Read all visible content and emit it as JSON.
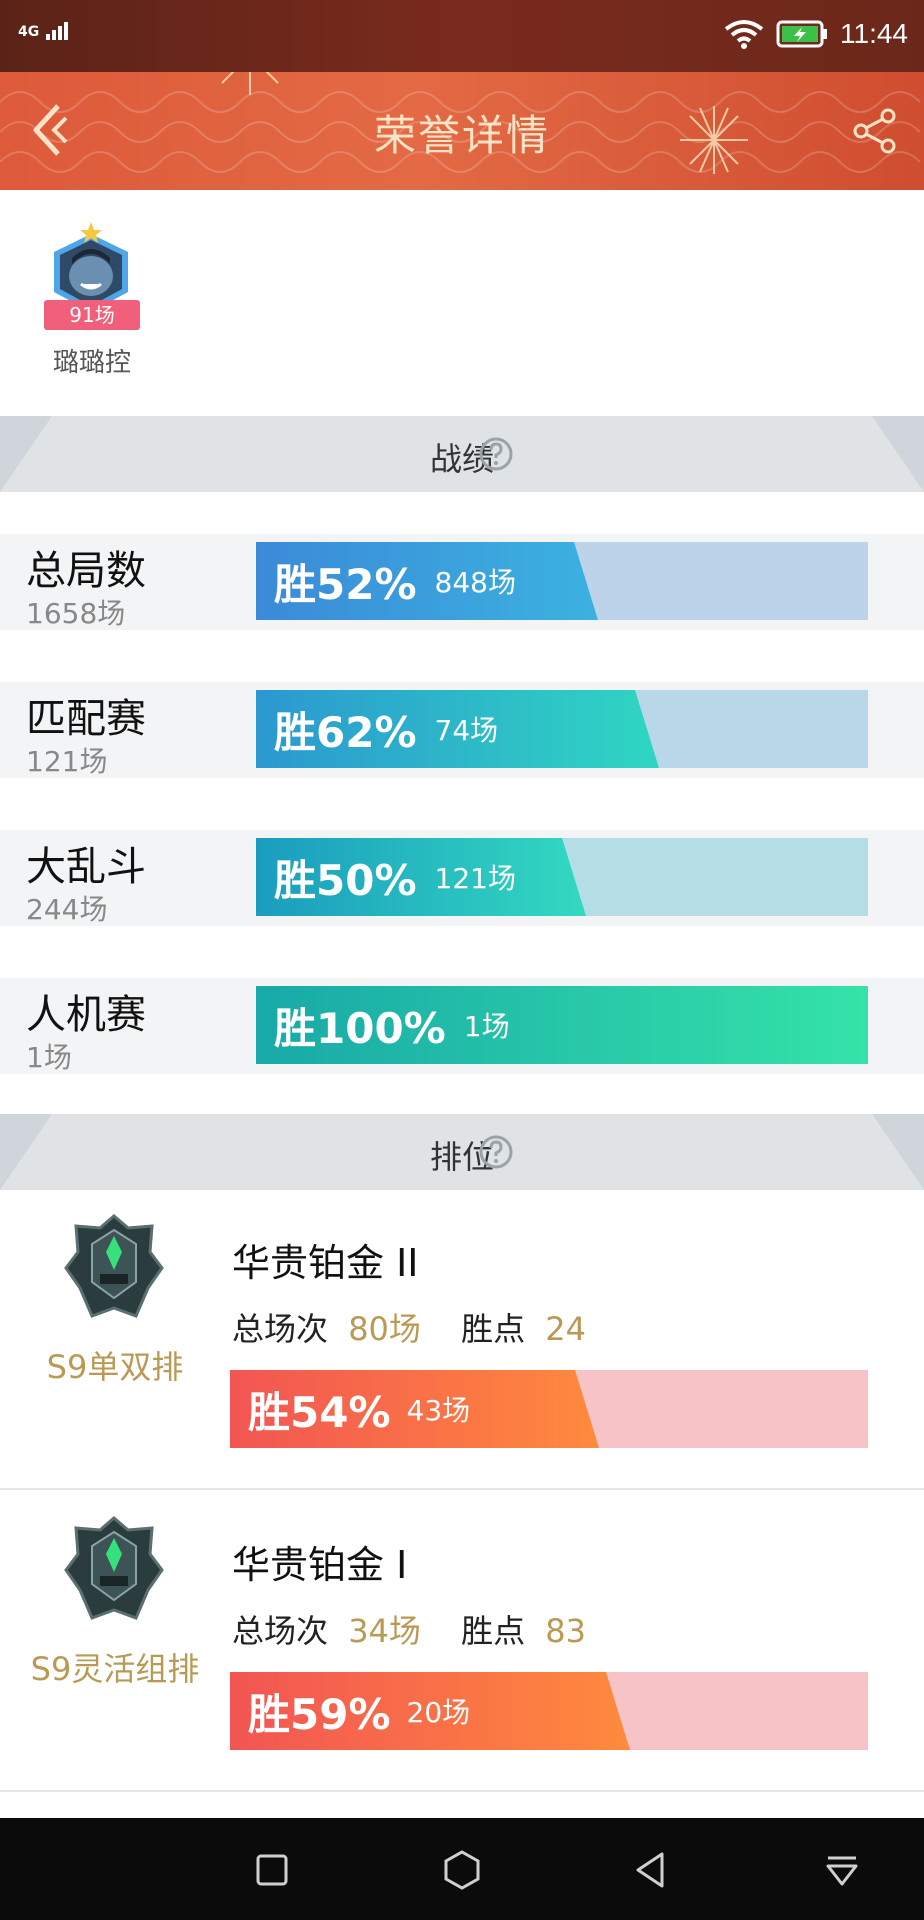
{
  "status_bar": {
    "network": "4G",
    "time": "11:44"
  },
  "header": {
    "title": "荣誉详情"
  },
  "hero": {
    "badge": "91场",
    "name": "璐璐控"
  },
  "stats_section": {
    "title": "战绩",
    "rows": [
      {
        "name": "总局数",
        "count": "1658场",
        "pct_label": "胜52%",
        "win_rate": 52,
        "games": "848场",
        "track": "#bcd3ea",
        "fill_from": "#3b8ad8",
        "fill_to": "#3bb2e0"
      },
      {
        "name": "匹配赛",
        "count": "121场",
        "pct_label": "胜62%",
        "win_rate": 62,
        "games": "74场",
        "track": "#b8d8ea",
        "fill_from": "#2b98d0",
        "fill_to": "#2fd6c2"
      },
      {
        "name": "大乱斗",
        "count": "244场",
        "pct_label": "胜50%",
        "win_rate": 50,
        "games": "121场",
        "track": "#b4dde5",
        "fill_from": "#1a9cbf",
        "fill_to": "#33d9c0"
      },
      {
        "name": "人机赛",
        "count": "1场",
        "pct_label": "胜100%",
        "win_rate": 100,
        "games": "1场",
        "track": "#b4e3d9",
        "fill_from": "#18a9a8",
        "fill_to": "#35e3a8"
      }
    ]
  },
  "ranked_section": {
    "title": "排位",
    "cards": [
      {
        "season": "S9单双排",
        "tier": "华贵铂金 II",
        "total_label": "总场次",
        "total": "80场",
        "points_label": "胜点",
        "points": "24",
        "pct_label": "胜54%",
        "win_rate": 54,
        "games": "43场"
      },
      {
        "season": "S9灵活组排",
        "tier": "华贵铂金 I",
        "total_label": "总场次",
        "total": "34场",
        "points_label": "胜点",
        "points": "83",
        "pct_label": "胜59%",
        "win_rate": 59,
        "games": "20场"
      }
    ]
  },
  "colors": {
    "header": "#e0603e",
    "rank_fill_from": "#f25553",
    "rank_fill_to": "#ff8a3d",
    "rank_track": "#f6c4c6",
    "gold": "#b99a55"
  }
}
